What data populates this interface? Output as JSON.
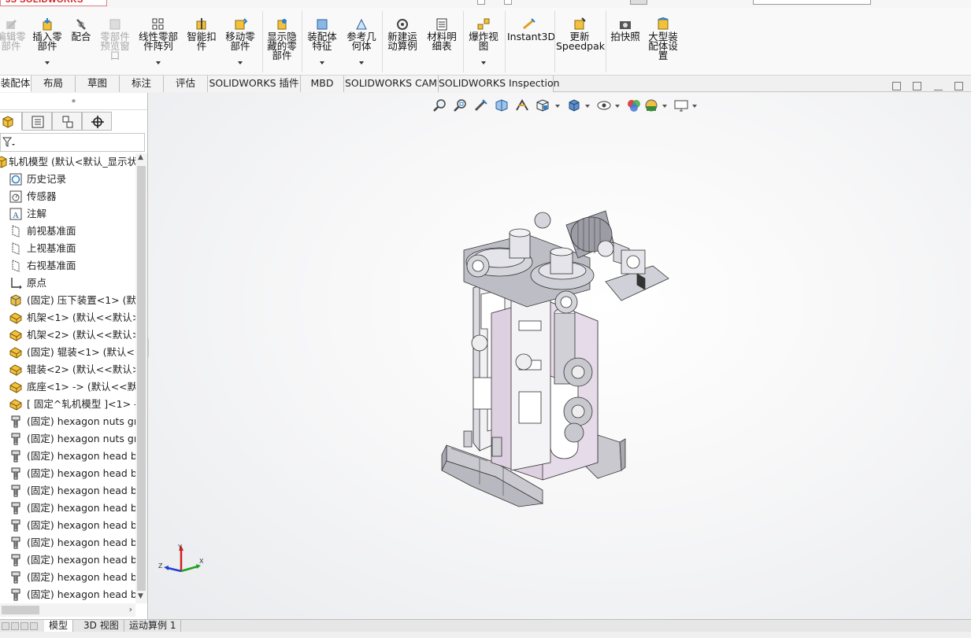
{
  "app": {
    "logo_text": "3S SOLIDWORKS"
  },
  "ribbon": {
    "tools": [
      {
        "label": "编辑零\n部件",
        "disabled": true,
        "icon": "edit-component-icon"
      },
      {
        "label": "插入零\n部件",
        "disabled": false,
        "icon": "insert-component-icon"
      },
      {
        "label": "配合",
        "disabled": false,
        "icon": "mate-icon"
      },
      {
        "label": "零部件\n预览窗\n口",
        "disabled": true,
        "icon": "component-preview-icon"
      },
      {
        "label": "线性零部\n件阵列",
        "disabled": false,
        "icon": "linear-pattern-icon"
      },
      {
        "label": "智能扣\n件",
        "disabled": false,
        "icon": "smart-fasteners-icon"
      },
      {
        "label": "移动零\n部件",
        "disabled": false,
        "icon": "move-component-icon"
      },
      {
        "label": "显示隐\n藏的零\n部件",
        "disabled": false,
        "icon": "show-hidden-icon"
      },
      {
        "label": "装配体\n特征",
        "disabled": false,
        "icon": "assembly-features-icon"
      },
      {
        "label": "参考几\n何体",
        "disabled": false,
        "icon": "reference-geometry-icon"
      },
      {
        "label": "新建运\n动算例",
        "disabled": false,
        "icon": "motion-study-icon"
      },
      {
        "label": "材料明\n细表",
        "disabled": false,
        "icon": "bom-icon"
      },
      {
        "label": "爆炸视\n图",
        "disabled": false,
        "icon": "exploded-view-icon"
      },
      {
        "label": "Instant3D",
        "disabled": false,
        "icon": "instant3d-icon"
      },
      {
        "label": "更新\nSpeedpak",
        "disabled": false,
        "icon": "speedpak-icon"
      },
      {
        "label": "拍快照",
        "disabled": false,
        "icon": "snapshot-icon"
      },
      {
        "label": "大型装\n配体设\n置",
        "disabled": false,
        "icon": "large-assembly-icon"
      }
    ]
  },
  "tabs": [
    "装配体",
    "布局",
    "草图",
    "标注",
    "评估",
    "SOLIDWORKS 插件",
    "MBD",
    "SOLIDWORKS CAM",
    "SOLIDWORKS Inspection"
  ],
  "tree": {
    "rows": [
      {
        "text": "轧机模型  (默认<默认_显示状",
        "icon": "assembly-icon"
      },
      {
        "text": "历史记录",
        "icon": "history-icon"
      },
      {
        "text": "传感器",
        "icon": "sensor-icon"
      },
      {
        "text": "注解",
        "icon": "annotation-icon"
      },
      {
        "text": "前视基准面",
        "icon": "plane-icon"
      },
      {
        "text": "上视基准面",
        "icon": "plane-icon"
      },
      {
        "text": "右视基准面",
        "icon": "plane-icon"
      },
      {
        "text": "原点",
        "icon": "origin-icon"
      },
      {
        "text": "(固定) 压下装置<1> (默认",
        "icon": "subassembly-icon"
      },
      {
        "text": "机架<1> (默认<<默认>_",
        "icon": "part-icon"
      },
      {
        "text": "机架<2> (默认<<默认>_",
        "icon": "part-icon"
      },
      {
        "text": "(固定) 辊装<1> (默认<<",
        "icon": "part-icon"
      },
      {
        "text": "辊装<2> (默认<<默认>_",
        "icon": "part-icon"
      },
      {
        "text": "底座<1> -> (默认<<默认",
        "icon": "part-icon"
      },
      {
        "text": "[ 固定^轧机模型 ]<1> ->",
        "icon": "part-icon"
      },
      {
        "text": "(固定) hexagon nuts gra",
        "icon": "bolt-icon"
      },
      {
        "text": "(固定) hexagon nuts gra",
        "icon": "bolt-icon"
      },
      {
        "text": "(固定) hexagon head bo",
        "icon": "bolt-icon"
      },
      {
        "text": "(固定) hexagon head bo",
        "icon": "bolt-icon"
      },
      {
        "text": "(固定) hexagon head bo",
        "icon": "bolt-icon"
      },
      {
        "text": "(固定) hexagon head bo",
        "icon": "bolt-icon"
      },
      {
        "text": "(固定) hexagon head bo",
        "icon": "bolt-icon"
      },
      {
        "text": "(固定) hexagon head bo",
        "icon": "bolt-icon"
      },
      {
        "text": "(固定) hexagon head bo",
        "icon": "bolt-icon"
      },
      {
        "text": "(固定) hexagon head bo",
        "icon": "bolt-icon"
      },
      {
        "text": "(固定) hexagon head bo",
        "icon": "bolt-icon"
      }
    ]
  },
  "triad": {
    "x": "X",
    "y": "Y",
    "z": "Z"
  },
  "bottom_tabs": [
    "模型",
    "3D 视图",
    "运动算例 1"
  ],
  "colors": {
    "accent": "#d21f1f",
    "frame": "#ddd0e0",
    "base": "#c9c9cf"
  }
}
